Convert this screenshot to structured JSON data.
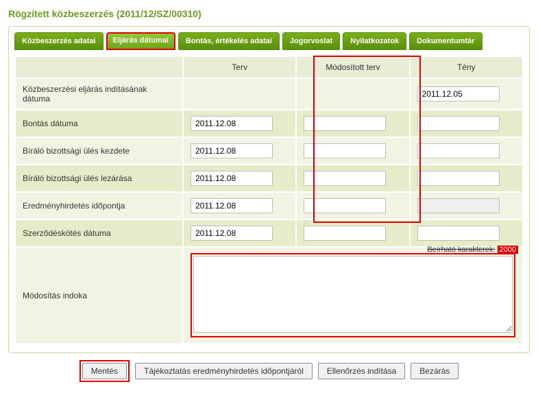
{
  "page_title": "Rögzített közbeszerzés (2011/12/SZ/00310)",
  "tabs": [
    {
      "label": "Közbeszerzés adatai"
    },
    {
      "label": "Eljárás dátumai",
      "active": true,
      "highlighted": true
    },
    {
      "label": "Bontás, értékelés adatai"
    },
    {
      "label": "Jogorvoslat"
    },
    {
      "label": "Nyilatkozatok"
    },
    {
      "label": "Dokumentumtár"
    }
  ],
  "columns": {
    "label": "",
    "terv": "Terv",
    "modositott": "Módosított terv",
    "teny": "Tény"
  },
  "rows": [
    {
      "label": "Közbeszerzési eljárás indításának dátuma",
      "terv": "",
      "modositott": "",
      "teny": "2011.12.05",
      "terv_input": false,
      "mod_input": false
    },
    {
      "label": "Bontás dátuma",
      "terv": "2011.12.08",
      "modositott": "",
      "teny": "",
      "terv_input": true,
      "mod_input": true,
      "teny_input": true
    },
    {
      "label": "Bíráló bizottsági ülés kezdete",
      "terv": "2011.12.08",
      "modositott": "",
      "teny": "",
      "terv_input": true,
      "mod_input": true,
      "teny_input": true
    },
    {
      "label": "Bíráló bizottsági ülés lezárása",
      "terv": "2011.12.08",
      "modositott": "",
      "teny": "",
      "terv_input": true,
      "mod_input": true,
      "teny_input": true
    },
    {
      "label": "Eredményhirdetés időpontja",
      "terv": "2011.12.08",
      "modositott": "",
      "teny": "",
      "terv_input": true,
      "mod_input": true,
      "teny_input": true,
      "teny_ro": true
    },
    {
      "label": "Szerződéskötés dátuma",
      "terv": "2011.12.08",
      "modositott": "",
      "teny": "",
      "terv_input": true,
      "mod_input": true,
      "teny_input": true
    }
  ],
  "reason": {
    "label": "Módosítás indoka",
    "value": "",
    "counter_prefix": "Beírható karakterek:",
    "counter_value": "2000"
  },
  "buttons": {
    "save": "Mentés",
    "notify": "Tájékoztatás eredményhirdetés időpontjáról",
    "check": "Ellenőrzés indítása",
    "close": "Bezárás"
  }
}
